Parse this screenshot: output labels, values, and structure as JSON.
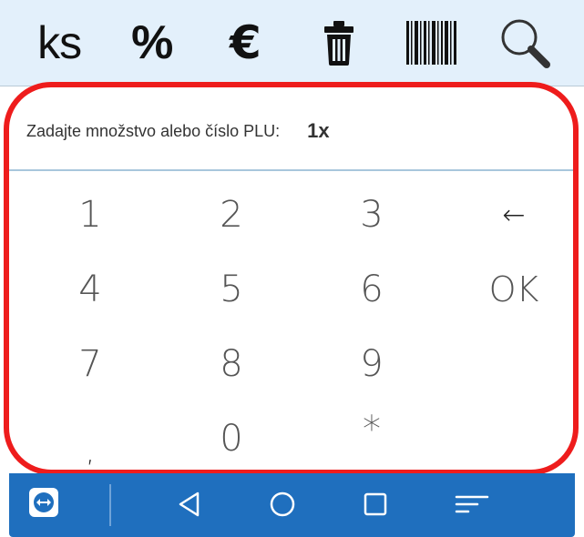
{
  "toolbar": {
    "unit_label": "ks",
    "percent_label": "%",
    "euro_label": "€"
  },
  "input": {
    "prompt": "Zadajte množstvo alebo číslo PLU:",
    "value": "1x"
  },
  "keypad": {
    "keys": [
      "1",
      "2",
      "3",
      "←",
      "4",
      "5",
      "6",
      "OK",
      "7",
      "8",
      "9",
      ",",
      "0",
      "*"
    ]
  },
  "icons": {
    "delete": "trash-icon",
    "barcode": "barcode-icon",
    "search": "search-icon",
    "app": "teamviewer-icon",
    "back": "back-icon",
    "home": "home-icon",
    "recents": "recents-icon",
    "menu": "menu-icon"
  },
  "colors": {
    "toolbar_bg": "#e3f0fb",
    "panel_border": "#ee1c1c",
    "nav_bg": "#1f6fbe"
  }
}
